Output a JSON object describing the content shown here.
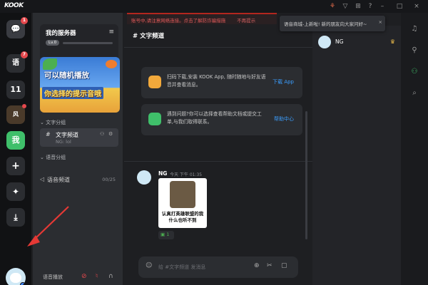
{
  "app": {
    "logo": "KOOK"
  },
  "warning": {
    "text": "账号中,请注意网络连接。点击了解防诈骗措施",
    "link": "不再提示"
  },
  "tooltip": {
    "text": "语音商城-上新啦! 新的朋友向大家问好~",
    "close": "×"
  },
  "rail": {
    "servers": [
      {
        "label": "💬",
        "badge": "1"
      },
      {
        "label": "语",
        "badge": "7"
      },
      {
        "label": "11"
      },
      {
        "label": "风"
      },
      {
        "label": "我"
      }
    ],
    "add_icon": "+",
    "discover_icon": "✦",
    "download_icon": "⤓"
  },
  "sidebar": {
    "server_name": "我的服务器",
    "level": "Lv.0",
    "banner_line1": "可以随机播放",
    "banner_line2": "你选择的提示音哦",
    "text_category": "文字分组",
    "text_channel": "文字频道",
    "text_channel_sub": "NG: lol",
    "voice_category": "语音分组",
    "voice_channel": "语音频道",
    "voice_count": "00/25",
    "voice_bar_label": "语音播放"
  },
  "main": {
    "channel_title": "文字频道",
    "cards": [
      {
        "text": "扫码下载,安装 KOOK App, 随时随地与好友语音并查看消息。",
        "link": "下载 App",
        "color": "#f2a93b"
      },
      {
        "text": "遇到问题?你可以选择查看帮助文档或提交工单,与我们取得联系。",
        "link": "帮助中心",
        "color": "#3fbf6a"
      }
    ],
    "message": {
      "author": "NG",
      "time": "今天 下午 01:35",
      "sticker_caption": "认真打英雄联盟的我 什么也听不到",
      "reaction_count": "1"
    },
    "input_placeholder": "给 #文字频道 发消息"
  },
  "members": {
    "name": "NG",
    "crown": "♛"
  },
  "right_rail": {
    "icons": [
      "bell-icon",
      "pin-icon",
      "members-icon",
      "search-icon"
    ]
  },
  "colors": {
    "accent": "#3fbf6a",
    "link": "#3b9eff",
    "danger": "#e5484d"
  }
}
